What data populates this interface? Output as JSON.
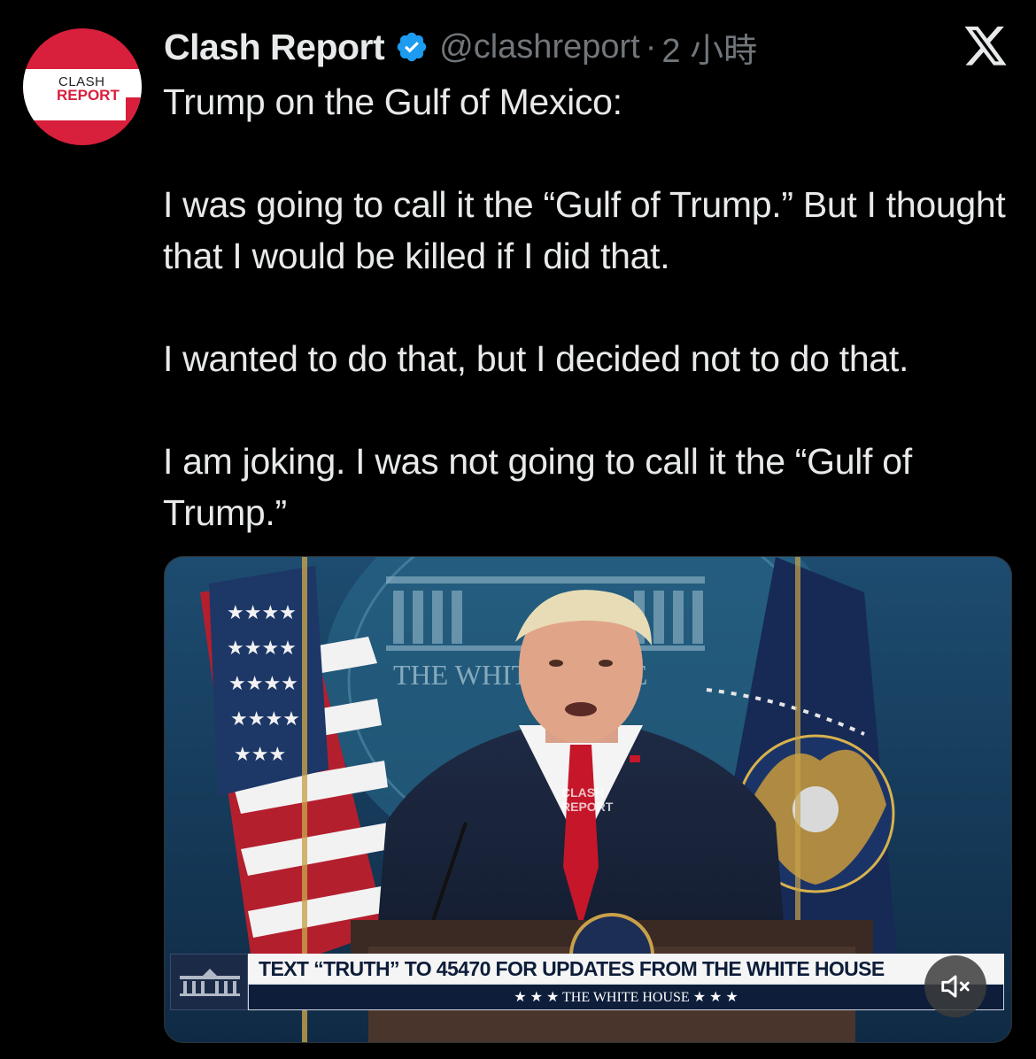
{
  "author": {
    "display_name": "Clash Report",
    "handle": "@clashreport",
    "separator": "·",
    "timestamp": "2 小時",
    "avatar_text_line1": "CLASH",
    "avatar_text_line2": "REPORT",
    "verified_icon": "verified-badge-icon"
  },
  "tweet": {
    "paragraphs": [
      "Trump on the Gulf of Mexico:",
      "I was going to call it the “Gulf of Trump.” But I thought that I would be killed if I did that.",
      "I wanted to do that, but I decided not to do that.",
      "I am joking. I was not going to call it the “Gulf of Trump.”"
    ]
  },
  "video": {
    "banner_main": "TEXT “TRUTH” TO 45470 FOR UPDATES FROM THE WHITE HOUSE",
    "banner_sub": "★ ★ ★   THE WHITE HOUSE   ★ ★ ★",
    "backdrop_text": "THE WHITE HOUSE",
    "watermark_line1": "CLASH",
    "watermark_line2": "REPORT",
    "mute_icon": "speaker-muted-icon"
  },
  "colors": {
    "background": "#000000",
    "text": "#e7e9ea",
    "muted": "#71767b",
    "verified": "#1d9bf0",
    "brand_red": "#d81f3c"
  }
}
